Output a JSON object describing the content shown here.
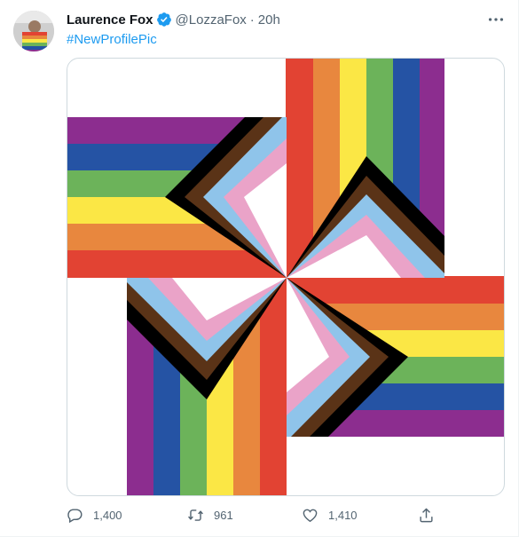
{
  "author": {
    "display_name": "Laurence Fox",
    "handle": "@LozzaFox",
    "separator": "·",
    "time": "20h"
  },
  "tweet": {
    "hashtag": "#NewProfilePic"
  },
  "actions": {
    "reply_count": "1,400",
    "retweet_count": "961",
    "like_count": "1,410"
  },
  "icons": {
    "verified": "verified-badge-icon",
    "more": "more-options-icon",
    "reply": "reply-icon",
    "retweet": "retweet-icon",
    "like": "heart-icon",
    "share": "share-icon"
  },
  "colors": {
    "accent": "#1d9bf0",
    "muted": "#536471",
    "rainbow": [
      "#e24333",
      "#e8873e",
      "#fbe745",
      "#6cb35a",
      "#2553a4",
      "#8c2d8f"
    ],
    "chevrons": [
      "#ffffff",
      "#eaa3c8",
      "#8fc4ea",
      "#5a3317",
      "#000000"
    ]
  }
}
